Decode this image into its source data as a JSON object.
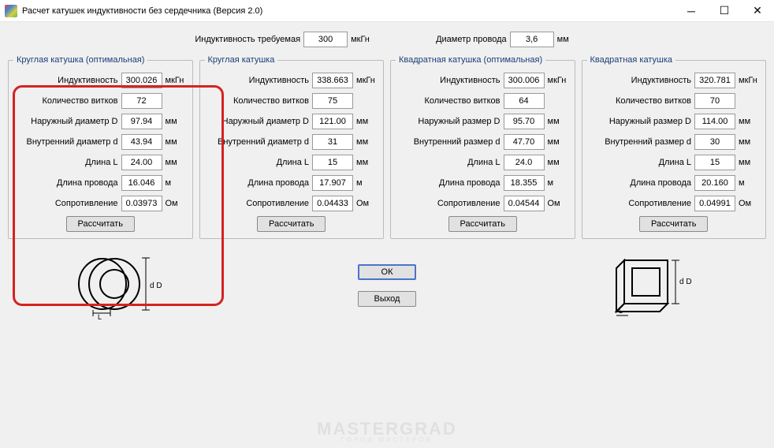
{
  "window": {
    "title": "Расчет катушек индуктивности без сердечника (Версия 2.0)"
  },
  "top": {
    "inductance_label": "Индуктивность требуемая",
    "inductance_value": "300",
    "inductance_unit": "мкГн",
    "wire_label": "Диаметр провода",
    "wire_value": "3,6",
    "wire_unit": "мм"
  },
  "labels": {
    "inductance": "Индуктивность",
    "turns": "Количество витков",
    "outer_d": "Наружный диаметр D",
    "inner_d": "Внутренний диаметр d",
    "outer_s": "Наружный размер D",
    "inner_s": "Внутренний размер d",
    "length": "Длина L",
    "wirelen": "Длина провода",
    "resistance": "Сопротивление",
    "calc": "Рассчитать",
    "unit_uh": "мкГн",
    "unit_mm": "мм",
    "unit_m": "м",
    "unit_ohm": "Ом"
  },
  "panels": [
    {
      "title": "Круглая катушка (оптимальная)",
      "inductance": "300.026",
      "turns": "72",
      "outer": "97.94",
      "inner": "43.94",
      "length": "24.00",
      "wirelen": "16.046",
      "resistance": "0.03973"
    },
    {
      "title": "Круглая катушка",
      "inductance": "338.663",
      "turns": "75",
      "outer": "121.00",
      "inner": "31",
      "length": "15",
      "wirelen": "17.907",
      "resistance": "0.04433"
    },
    {
      "title": "Квадратная катушка (оптимальная)",
      "inductance": "300.006",
      "turns": "64",
      "outer": "95.70",
      "inner": "47.70",
      "length": "24.0",
      "wirelen": "18.355",
      "resistance": "0.04544"
    },
    {
      "title": "Квадратная катушка",
      "inductance": "320.781",
      "turns": "70",
      "outer": "114.00",
      "inner": "30",
      "length": "15",
      "wirelen": "20.160",
      "resistance": "0.04991"
    }
  ],
  "buttons": {
    "ok": "ОК",
    "exit": "Выход"
  },
  "watermark": {
    "main": "MASTERGRAD",
    "sub": "ГОРОД МАСТЕРОВ"
  }
}
